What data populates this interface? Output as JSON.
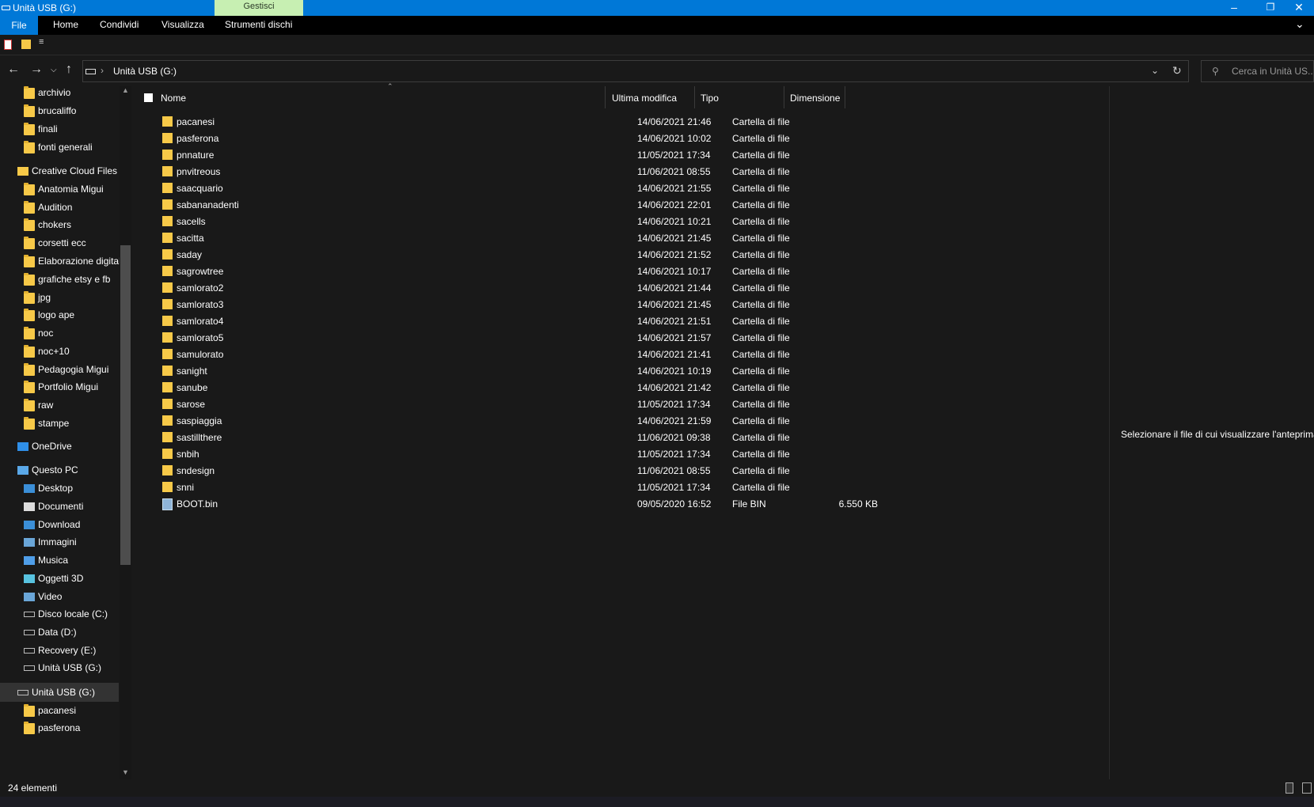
{
  "window": {
    "title": "Unità USB (G:)",
    "context_tab": "Gestisci"
  },
  "ribbon": {
    "tabs": [
      "File",
      "Home",
      "Condividi",
      "Visualizza",
      "Strumenti dischi"
    ]
  },
  "address": {
    "path": "Unità USB (G:)",
    "search_placeholder": "Cerca in Unità US..."
  },
  "columns": {
    "name": "Nome",
    "modified": "Ultima modifica",
    "type": "Tipo",
    "size": "Dimensione"
  },
  "nav": {
    "items": [
      {
        "label": "archivio",
        "icon": "folder-icon"
      },
      {
        "label": "brucaliffo",
        "icon": "folder-icon"
      },
      {
        "label": "finali",
        "icon": "folder-icon"
      },
      {
        "label": "fonti generali",
        "icon": "folder-icon"
      },
      {
        "label": "Creative Cloud Files",
        "icon": "creative-cloud-icon"
      },
      {
        "label": "Anatomia Migui",
        "icon": "folder-icon"
      },
      {
        "label": "Audition",
        "icon": "folder-icon"
      },
      {
        "label": "chokers",
        "icon": "folder-icon"
      },
      {
        "label": "corsetti ecc",
        "icon": "folder-icon"
      },
      {
        "label": "Elaborazione digitale",
        "icon": "folder-icon"
      },
      {
        "label": "grafiche etsy e fb",
        "icon": "folder-icon"
      },
      {
        "label": "jpg",
        "icon": "folder-icon"
      },
      {
        "label": "logo ape",
        "icon": "folder-icon"
      },
      {
        "label": "noc",
        "icon": "folder-icon"
      },
      {
        "label": "noc+10",
        "icon": "folder-icon"
      },
      {
        "label": "Pedagogia Migui",
        "icon": "folder-icon"
      },
      {
        "label": "Portfolio Migui",
        "icon": "folder-icon"
      },
      {
        "label": "raw",
        "icon": "folder-icon"
      },
      {
        "label": "stampe",
        "icon": "folder-icon"
      },
      {
        "label": "OneDrive",
        "icon": "cloud-icon"
      },
      {
        "label": "Questo PC",
        "icon": "pc-icon"
      },
      {
        "label": "Desktop",
        "icon": "desktop-icon"
      },
      {
        "label": "Documenti",
        "icon": "document-icon"
      },
      {
        "label": "Download",
        "icon": "download-icon"
      },
      {
        "label": "Immagini",
        "icon": "image-icon"
      },
      {
        "label": "Musica",
        "icon": "music-icon"
      },
      {
        "label": "Oggetti 3D",
        "icon": "cube-icon"
      },
      {
        "label": "Video",
        "icon": "video-icon"
      },
      {
        "label": "Disco locale (C:)",
        "icon": "drive-icon"
      },
      {
        "label": "Data (D:)",
        "icon": "drive-icon"
      },
      {
        "label": "Recovery (E:)",
        "icon": "drive-icon"
      },
      {
        "label": "Unità USB (G:)",
        "icon": "usb-drive-icon"
      },
      {
        "label": "Unità USB (G:)",
        "icon": "usb-drive-icon"
      },
      {
        "label": "pacanesi",
        "icon": "folder-icon"
      },
      {
        "label": "pasferona",
        "icon": "folder-icon"
      }
    ]
  },
  "files": [
    {
      "name": "pacanesi",
      "modified": "14/06/2021 21:46",
      "type": "Cartella di file",
      "size": ""
    },
    {
      "name": "pasferona",
      "modified": "14/06/2021 10:02",
      "type": "Cartella di file",
      "size": ""
    },
    {
      "name": "pnnature",
      "modified": "11/05/2021 17:34",
      "type": "Cartella di file",
      "size": ""
    },
    {
      "name": "pnvitreous",
      "modified": "11/06/2021 08:55",
      "type": "Cartella di file",
      "size": ""
    },
    {
      "name": "saacquario",
      "modified": "14/06/2021 21:55",
      "type": "Cartella di file",
      "size": ""
    },
    {
      "name": "sabananadenti",
      "modified": "14/06/2021 22:01",
      "type": "Cartella di file",
      "size": ""
    },
    {
      "name": "sacells",
      "modified": "14/06/2021 10:21",
      "type": "Cartella di file",
      "size": ""
    },
    {
      "name": "sacitta",
      "modified": "14/06/2021 21:45",
      "type": "Cartella di file",
      "size": ""
    },
    {
      "name": "saday",
      "modified": "14/06/2021 21:52",
      "type": "Cartella di file",
      "size": ""
    },
    {
      "name": "sagrowtree",
      "modified": "14/06/2021 10:17",
      "type": "Cartella di file",
      "size": ""
    },
    {
      "name": "samlorato2",
      "modified": "14/06/2021 21:44",
      "type": "Cartella di file",
      "size": ""
    },
    {
      "name": "samlorato3",
      "modified": "14/06/2021 21:45",
      "type": "Cartella di file",
      "size": ""
    },
    {
      "name": "samlorato4",
      "modified": "14/06/2021 21:51",
      "type": "Cartella di file",
      "size": ""
    },
    {
      "name": "samlorato5",
      "modified": "14/06/2021 21:57",
      "type": "Cartella di file",
      "size": ""
    },
    {
      "name": "samulorato",
      "modified": "14/06/2021 21:41",
      "type": "Cartella di file",
      "size": ""
    },
    {
      "name": "sanight",
      "modified": "14/06/2021 10:19",
      "type": "Cartella di file",
      "size": ""
    },
    {
      "name": "sanube",
      "modified": "14/06/2021 21:42",
      "type": "Cartella di file",
      "size": ""
    },
    {
      "name": "sarose",
      "modified": "11/05/2021 17:34",
      "type": "Cartella di file",
      "size": ""
    },
    {
      "name": "saspiaggia",
      "modified": "14/06/2021 21:59",
      "type": "Cartella di file",
      "size": ""
    },
    {
      "name": "sastillthere",
      "modified": "11/06/2021 09:38",
      "type": "Cartella di file",
      "size": ""
    },
    {
      "name": "snbih",
      "modified": "11/05/2021 17:34",
      "type": "Cartella di file",
      "size": ""
    },
    {
      "name": "sndesign",
      "modified": "11/06/2021 08:55",
      "type": "Cartella di file",
      "size": ""
    },
    {
      "name": "snni",
      "modified": "11/05/2021 17:34",
      "type": "Cartella di file",
      "size": ""
    },
    {
      "name": "BOOT.bin",
      "modified": "09/05/2020 16:52",
      "type": "File BIN",
      "size": "6.550 KB"
    }
  ],
  "preview": {
    "message": "Selezionare il file di cui visualizzare l'anteprima."
  },
  "status": {
    "count": "24 elementi"
  },
  "colors": {
    "accent": "#0078d7",
    "manage_tab": "#c7efb2",
    "folder": "#f7c948",
    "background": "#191919"
  }
}
